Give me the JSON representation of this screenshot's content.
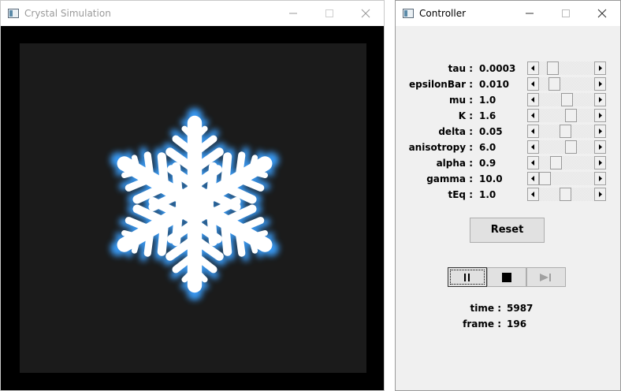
{
  "crystal_window": {
    "title": "Crystal Simulation",
    "app_icon": "window-app-icon",
    "title_color": "#9a9a9a",
    "canvas_background": "#1b1b1b",
    "crystal_colors": {
      "core": "#ffffff",
      "glow": "#3aa0ff"
    }
  },
  "controller_window": {
    "title": "Controller",
    "app_icon": "window-app-icon",
    "params": [
      {
        "label": "tau :",
        "value": "0.0003",
        "position": 0.18
      },
      {
        "label": "epsilonBar :",
        "value": "0.010",
        "position": 0.22
      },
      {
        "label": "mu :",
        "value": "1.0",
        "position": 0.5
      },
      {
        "label": "K :",
        "value": "1.6",
        "position": 0.6
      },
      {
        "label": "delta :",
        "value": "0.05",
        "position": 0.47
      },
      {
        "label": "anisotropy :",
        "value": "6.0",
        "position": 0.6
      },
      {
        "label": "alpha :",
        "value": "0.9",
        "position": 0.26
      },
      {
        "label": "gamma :",
        "value": "10.0",
        "position": 0.0
      },
      {
        "label": "tEq :",
        "value": "1.0",
        "position": 0.47
      }
    ],
    "reset_label": "Reset",
    "playback": {
      "pause_icon": "pause-icon",
      "stop_icon": "stop-icon",
      "step_icon": "step-forward-icon"
    },
    "stats": [
      {
        "label": "time :",
        "value": "5987"
      },
      {
        "label": "frame :",
        "value": "196"
      }
    ]
  }
}
